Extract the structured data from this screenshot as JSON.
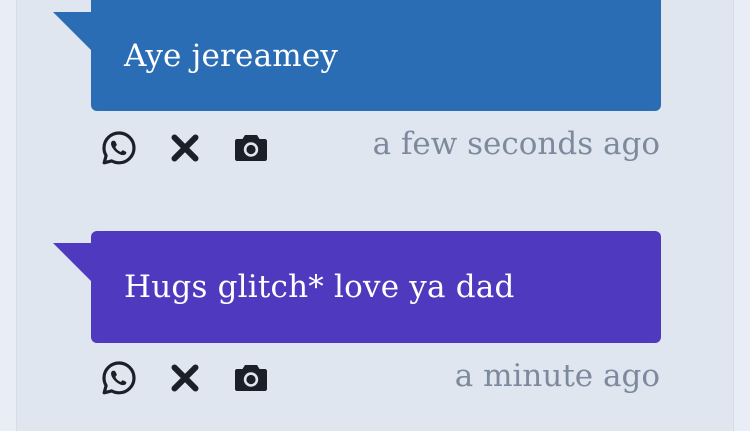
{
  "colors": {
    "bubble_blue": "#2a6db5",
    "bubble_purple": "#4f39be",
    "icon": "#1b1f27",
    "timestamp": "#7d8a9e",
    "panel_bg": "#e0e6ef"
  },
  "messages": [
    {
      "text": "Aye jereamey",
      "timestamp": "a few seconds ago",
      "bubble_color": "#2a6db5",
      "actions": [
        {
          "icon": "whatsapp-icon"
        },
        {
          "icon": "close-icon"
        },
        {
          "icon": "camera-icon"
        }
      ]
    },
    {
      "text": "Hugs glitch* love ya dad",
      "timestamp": "a minute ago",
      "bubble_color": "#4f39be",
      "actions": [
        {
          "icon": "whatsapp-icon"
        },
        {
          "icon": "close-icon"
        },
        {
          "icon": "camera-icon"
        }
      ]
    }
  ]
}
